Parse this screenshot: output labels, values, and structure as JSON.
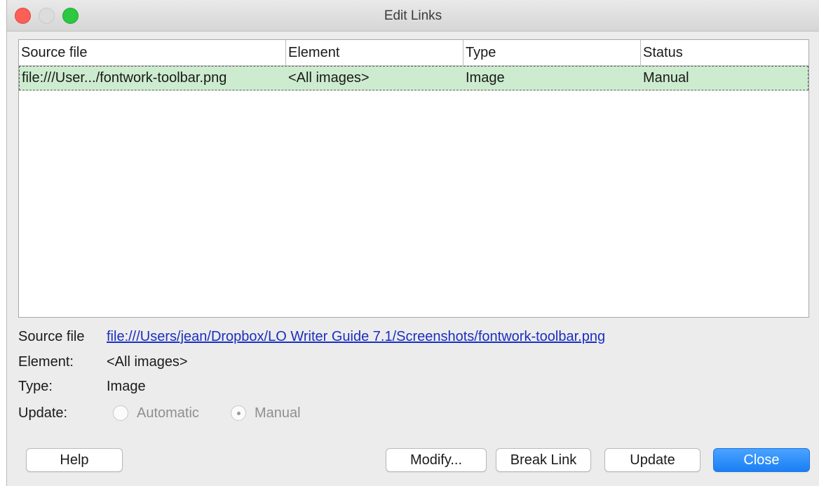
{
  "window": {
    "title": "Edit Links"
  },
  "table": {
    "columns": [
      "Source file",
      "Element",
      "Type",
      "Status"
    ],
    "rows": [
      {
        "source_file": "file:///User.../fontwork-toolbar.png",
        "element": "<All images>",
        "type": "Image",
        "status": "Manual"
      }
    ]
  },
  "details": {
    "source_file_label": "Source file",
    "source_file_value": "file:///Users/jean/Dropbox/LO Writer Guide 7.1/Screenshots/fontwork-toolbar.png",
    "element_label": "Element:",
    "element_value": "<All images>",
    "type_label": "Type:",
    "type_value": "Image",
    "update_label": "Update:",
    "update_options": [
      {
        "label": "Automatic",
        "checked": false
      },
      {
        "label": "Manual",
        "checked": true
      }
    ]
  },
  "buttons": {
    "help": "Help",
    "modify": "Modify...",
    "break_link": "Break Link",
    "update": "Update",
    "close": "Close"
  },
  "colors": {
    "accent": "#1a7ff5",
    "selection": "#cdeccf",
    "link": "#1a2fbf"
  }
}
